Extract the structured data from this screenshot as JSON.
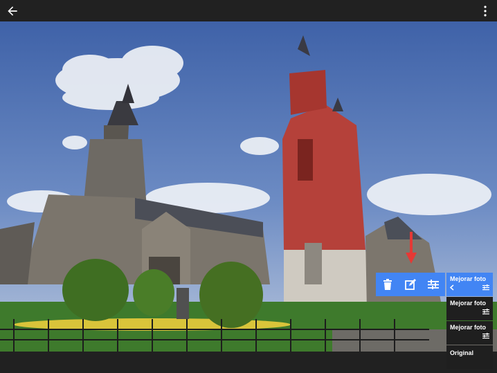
{
  "toolbar_colors": {
    "accent": "#4285f4",
    "bar": "#212121",
    "arrow": "#e53935"
  },
  "icons": {
    "back": "arrow-left-icon",
    "menu": "more-vert-icon",
    "delete": "trash-icon",
    "edit": "edit-icon",
    "adjust": "sliders-icon"
  },
  "filters": [
    {
      "label": "Mejorar foto",
      "selected": true
    },
    {
      "label": "Mejorar foto",
      "selected": false
    },
    {
      "label": "Mejorar foto",
      "selected": false
    },
    {
      "label": "Original",
      "selected": false
    }
  ]
}
